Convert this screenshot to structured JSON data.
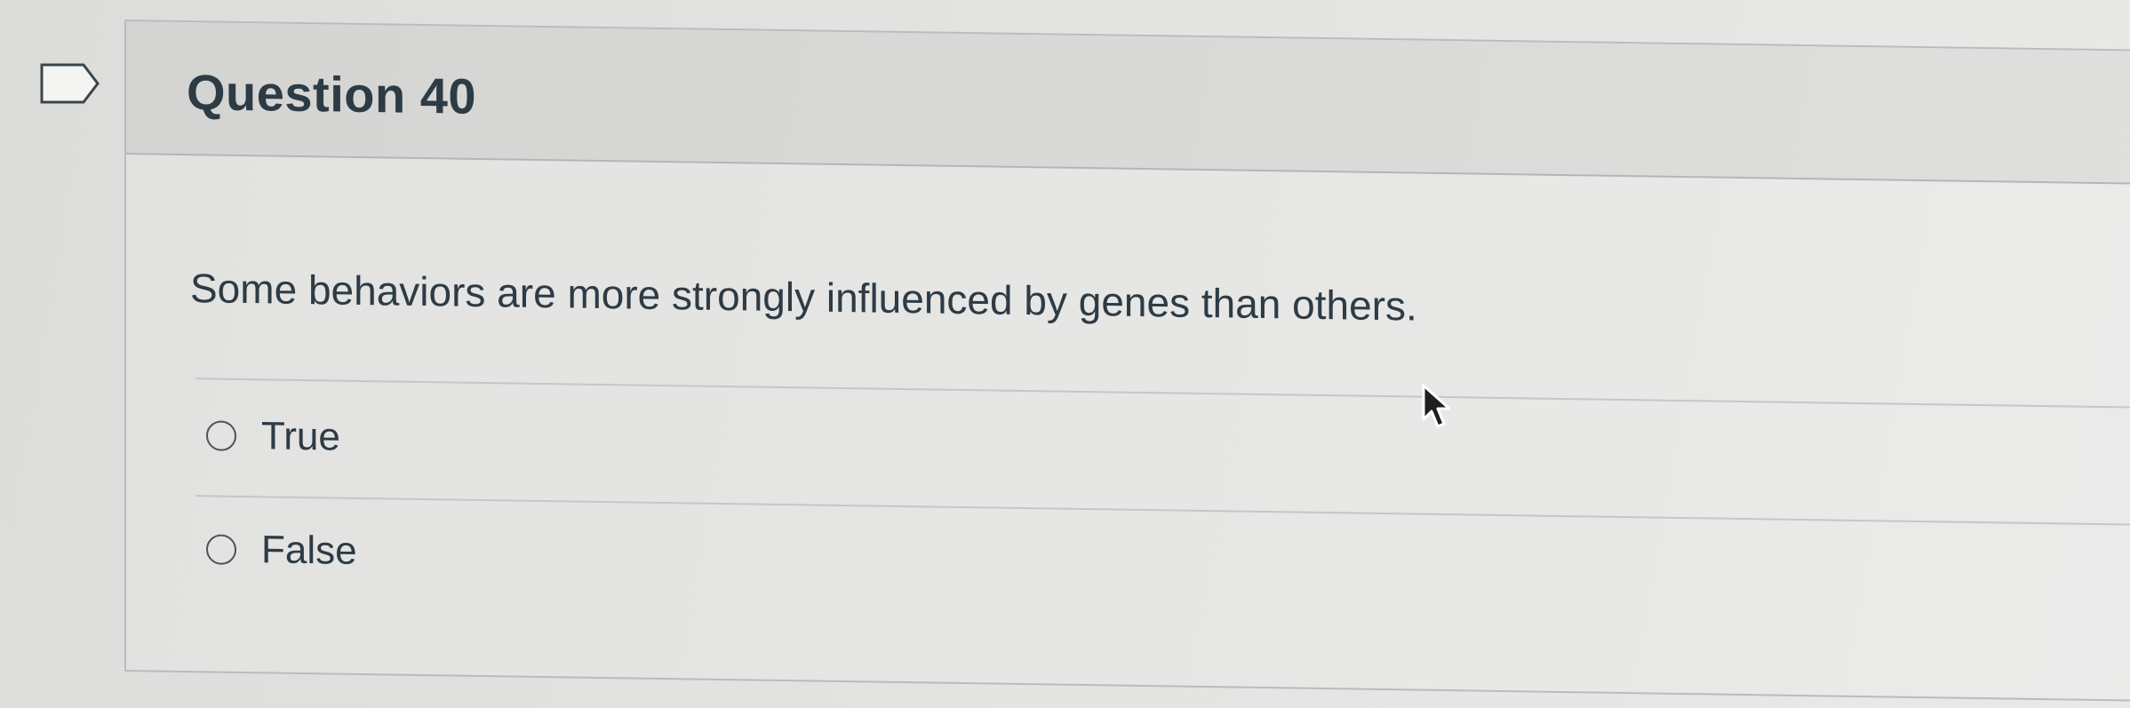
{
  "question": {
    "title": "Question 40",
    "text": "Some behaviors are more strongly influenced by genes than others."
  },
  "answers": [
    {
      "label": "True",
      "selected": false
    },
    {
      "label": "False",
      "selected": false
    }
  ],
  "icons": {
    "flag": "flag-question-icon",
    "cursor": "mouse-cursor-icon"
  },
  "colors": {
    "text": "#2d3b45",
    "header_bg": "#d8d8d6",
    "border": "#b9bcbd"
  }
}
